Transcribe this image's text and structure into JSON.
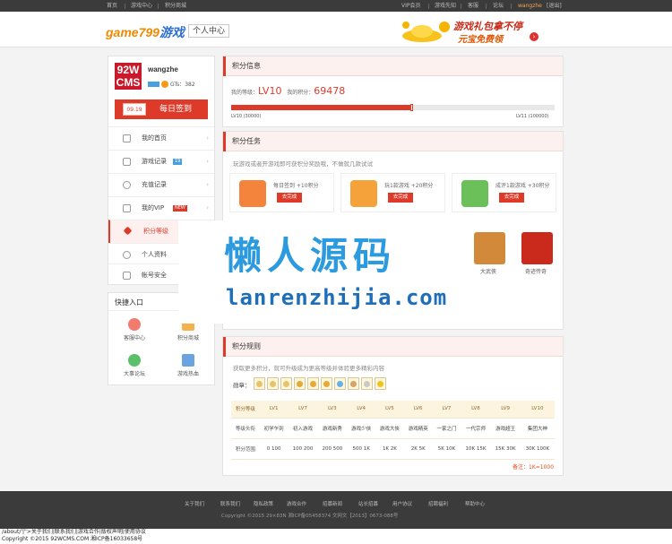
{
  "topbar": {
    "links": [
      "首页",
      "游戏中心",
      "积分商城"
    ],
    "right": [
      "VIP会员",
      "游戏先知",
      "客服",
      "论坛"
    ],
    "username": "wangzhe",
    "logout": "[退出]"
  },
  "header": {
    "logo_a": "game799",
    "logo_b": "游戏",
    "center_label": "个人中心",
    "promo_line1": "游戏礼包拿不停",
    "promo_line2": "元宝免费领",
    "promo_arrow": "›"
  },
  "profile": {
    "avatar_line1": "92W",
    "avatar_line2": "CMS",
    "name": "wangzhe",
    "gt_label": "GTs：382",
    "sign_date": "09.19",
    "sign_label": "每日签到"
  },
  "nav": [
    {
      "label": "我的首页"
    },
    {
      "label": "游戏记录",
      "tag": "19"
    },
    {
      "label": "充值记录"
    },
    {
      "label": "我的VIP",
      "tag": "NEW"
    },
    {
      "label": "积分等级"
    },
    {
      "label": "个人资料"
    },
    {
      "label": "帐号安全"
    }
  ],
  "quick": {
    "title": "快捷入口",
    "items": [
      "客服中心",
      "积分商城",
      "大事论坛",
      "游戏热血"
    ]
  },
  "points": {
    "title": "积分信息",
    "level_label": "我的等级：",
    "level_value": "LV10",
    "points_label": "我的积分：",
    "points_value": "69478",
    "progress": 0.56,
    "left_label": "LV10 (30000)",
    "right_label": "LV11 (100000)"
  },
  "tasks": {
    "title": "积分任务",
    "desc": "玩游戏或者开游戏即可获积分奖励哦，不做就几款试试",
    "items": [
      {
        "text": "每日签到 +10积分",
        "button": "去完成",
        "icon": "calendar-icon",
        "color": "#f4843c"
      },
      {
        "text": "玩1款游戏 +20积分",
        "button": "去完成",
        "icon": "gamepad-icon",
        "color": "#f6a23a"
      },
      {
        "text": "成评1款游戏 +30积分",
        "button": "去完成",
        "icon": "chat-icon",
        "color": "#6cc05a"
      }
    ],
    "games": [
      "大武侠",
      "奇迹传奇"
    ]
  },
  "watermark": {
    "line1": "懒人源码",
    "line2": "lanrenzhijia.com"
  },
  "rules": {
    "title": "积分规则",
    "desc": "获取更多积分，就可升级成为更高等级并体验更多精彩内容",
    "medal_label": "勋章：",
    "medal_colors": [
      "#e8c36a",
      "#e8c36a",
      "#e8c36a",
      "#e5a93a",
      "#e5a93a",
      "#e5a93a",
      "#6aaee8",
      "#d9a06a",
      "#c9c9c9",
      "#f0c420"
    ],
    "table": [
      [
        "积分等级",
        "LV1",
        "LV7",
        "LV3",
        "LV4",
        "LV5",
        "LV6",
        "LV7",
        "LV8",
        "LV9",
        "LV10"
      ],
      [
        "等级头衔",
        "初学乍到",
        "初入游戏",
        "游戏新秀",
        "游戏少侠",
        "游戏大侠",
        "游戏精英",
        "一家之门",
        "一代宗师",
        "游戏超王",
        "集团大神"
      ],
      [
        "积分范围",
        "0 100",
        "100 200",
        "200 500",
        "500 1K",
        "1K 2K",
        "2K 5K",
        "5K 10K",
        "10K 15K",
        "15K 30K",
        "30K 100K"
      ]
    ],
    "note": "备注：1K=1000"
  },
  "footer": {
    "links": [
      "关于我们",
      "联系我们",
      "隐私政策",
      "游戏合作",
      "招募新闻",
      "站长招募",
      "用户协议",
      "招聘福利",
      "帮助中心"
    ],
    "copyright": "Copyright  ©2015 29×83N  湘ICP备05458374  文网文【2013】0673-088号"
  },
  "bottom": {
    "line1": "/about/'|\">关于我们|联系我们|游戏合作|版权声明|使用协议",
    "line2": "Copyright  ©2015 92WCMS.COM  湘ICP备16033658号"
  }
}
